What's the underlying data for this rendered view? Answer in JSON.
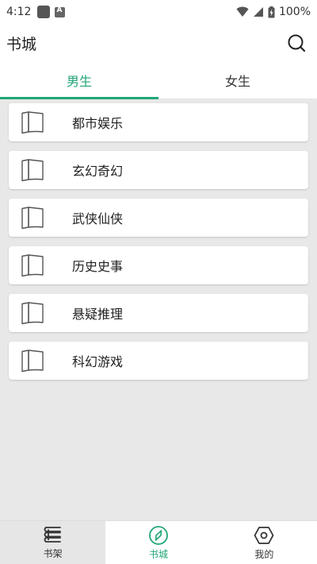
{
  "status_bar": {
    "time": "4:12",
    "battery": "100%"
  },
  "app_bar": {
    "title": "书城",
    "search_icon": "search-icon"
  },
  "tabs": [
    {
      "label": "男生",
      "active": true
    },
    {
      "label": "女生",
      "active": false
    }
  ],
  "categories": [
    {
      "label": "都市娱乐",
      "icon": "book-icon"
    },
    {
      "label": "玄幻奇幻",
      "icon": "book-icon"
    },
    {
      "label": "武侠仙侠",
      "icon": "book-icon"
    },
    {
      "label": "历史史事",
      "icon": "book-icon"
    },
    {
      "label": "悬疑推理",
      "icon": "book-icon"
    },
    {
      "label": "科幻游戏",
      "icon": "book-icon"
    }
  ],
  "bottom_nav": [
    {
      "label": "书架",
      "icon": "bookshelf-icon"
    },
    {
      "label": "书城",
      "icon": "compass-icon",
      "active": true
    },
    {
      "label": "我的",
      "icon": "profile-hexagon-icon"
    }
  ],
  "colors": {
    "accent": "#21a675",
    "list_background": "#e8e8e8"
  }
}
